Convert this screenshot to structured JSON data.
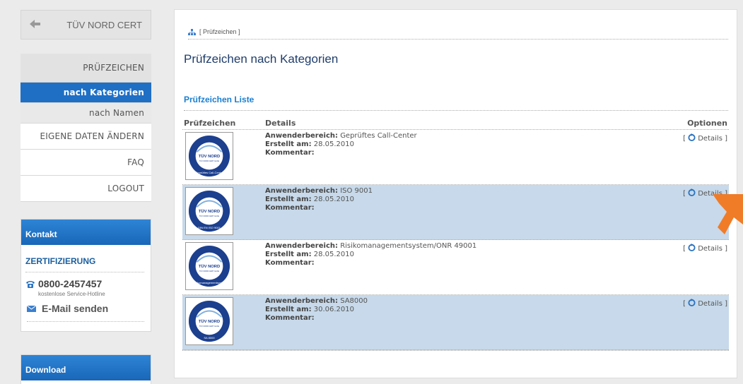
{
  "sidebar": {
    "back_label": "TÜV NORD CERT",
    "menu": {
      "header": "PRÜFZEICHEN",
      "active": "nach Kategorien",
      "sub": "nach Namen",
      "items": [
        "EIGENE DATEN ÄNDERN",
        "FAQ",
        "LOGOUT"
      ]
    },
    "kontakt": {
      "title": "Kontakt",
      "section": "ZERTIFIZIERUNG",
      "phone": "0800-2457457",
      "hotline": "kostenlose Service-Hotline",
      "email": "E-Mail senden"
    },
    "download": {
      "title": "Download"
    }
  },
  "main": {
    "breadcrumb": "[ Prüfzeichen ]",
    "title": "Prüfzeichen nach Kategorien",
    "list_title": "Prüfzeichen Liste",
    "columns": [
      "Prüfzeichen",
      "Details",
      "Optionen"
    ],
    "labels": {
      "bereich": "Anwenderbereich:",
      "erstellt": "Erstellt am:",
      "kommentar": "Kommentar:"
    },
    "rows": [
      {
        "seal_text": "Geprüftes Call-Center",
        "bereich": "Geprüftes Call-Center",
        "erstellt": "28.05.2010",
        "kommentar": "",
        "option": "Details",
        "highlight": false
      },
      {
        "seal_text": "DIN EN ISO 9001",
        "bereich": "ISO 9001",
        "erstellt": "28.05.2010",
        "kommentar": "",
        "option": "Details",
        "highlight": true
      },
      {
        "seal_text": "Risikomanagementsystem",
        "bereich": "Risikomanagementsystem/ONR 49001",
        "erstellt": "28.05.2010",
        "kommentar": "",
        "option": "Details",
        "highlight": false
      },
      {
        "seal_text": "SA 8000",
        "bereich": "SA8000",
        "erstellt": "30.06.2010",
        "kommentar": "",
        "option": "Details",
        "highlight": true
      }
    ],
    "seal_logo": "TÜV NORD",
    "seal_sub": "TÜV NORD CERT GmbH"
  },
  "colors": {
    "accent": "#1f6fc5",
    "highlight_row": "#c7d9ea",
    "cursor": "#f07c27"
  },
  "icons": [
    "back-arrow-icon",
    "sitemap-icon",
    "phone-icon",
    "mail-icon",
    "refresh-icon",
    "cursor-arrow-icon"
  ]
}
